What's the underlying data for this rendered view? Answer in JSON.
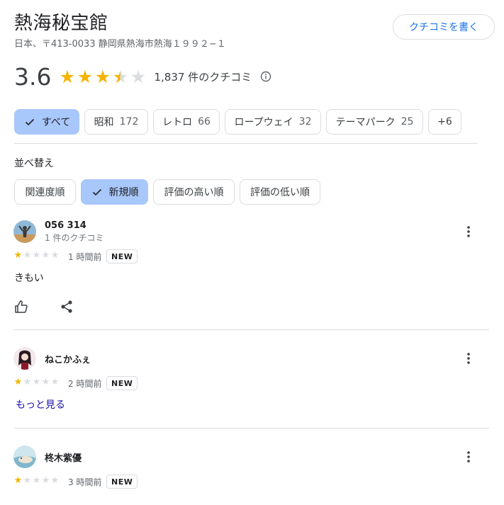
{
  "place": {
    "title": "熱海秘宝館",
    "address": "日本、〒413-0033 静岡県熱海市熱海１９９２−１",
    "write_review_label": "クチコミを書く"
  },
  "rating": {
    "value": "3.6",
    "stars_value": 3.6,
    "review_count_text": "1,837 件のクチコミ",
    "star_color": "#f4b400"
  },
  "filters": [
    {
      "label": "すべて",
      "count": "",
      "selected": true
    },
    {
      "label": "昭和",
      "count": "172",
      "selected": false
    },
    {
      "label": "レトロ",
      "count": "66",
      "selected": false
    },
    {
      "label": "ロープウェイ",
      "count": "32",
      "selected": false
    },
    {
      "label": "テーマパーク",
      "count": "25",
      "selected": false
    },
    {
      "label": "+6",
      "count": "",
      "selected": false
    }
  ],
  "sort": {
    "label": "並べ替え",
    "options": [
      {
        "label": "関連度順",
        "selected": false
      },
      {
        "label": "新規順",
        "selected": true
      },
      {
        "label": "評価の高い順",
        "selected": false
      },
      {
        "label": "評価の低い順",
        "selected": false
      }
    ]
  },
  "reviews": [
    {
      "name": "056 314",
      "sub": "1 件のクチコミ",
      "stars": 1,
      "time": "1 時間前",
      "badge": "NEW",
      "text": "きもい",
      "more_link": ""
    },
    {
      "name": "ねこかふぇ",
      "sub": "",
      "stars": 1,
      "time": "2 時間前",
      "badge": "NEW",
      "text": "",
      "more_link": "もっと見る"
    },
    {
      "name": "柊木紫優",
      "sub": "",
      "stars": 1,
      "time": "3 時間前",
      "badge": "NEW",
      "text": "",
      "more_link": ""
    }
  ],
  "colors": {
    "accent": "#1a73e8",
    "selected_chip": "#a8c7fa",
    "link": "#1a0dab"
  }
}
